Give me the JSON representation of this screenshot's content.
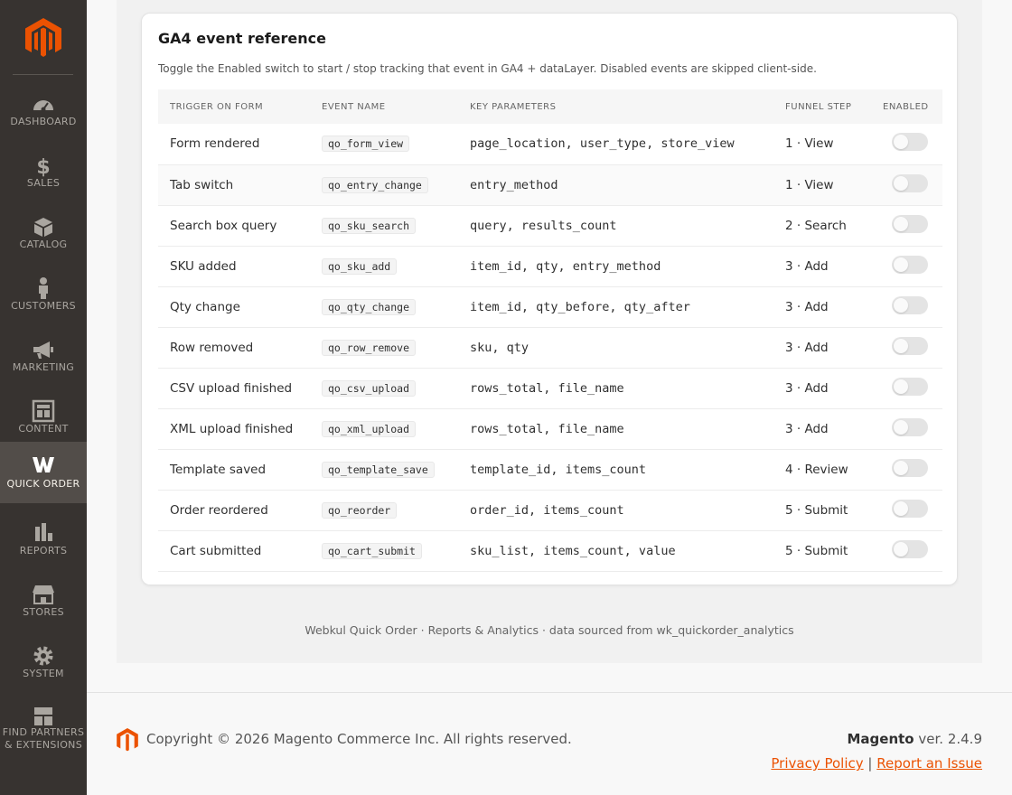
{
  "sidebar": {
    "items": [
      {
        "label": "DASHBOARD",
        "icon": "dashboard-icon"
      },
      {
        "label": "SALES",
        "icon": "dollar-icon"
      },
      {
        "label": "CATALOG",
        "icon": "box-icon"
      },
      {
        "label": "CUSTOMERS",
        "icon": "person-icon"
      },
      {
        "label": "MARKETING",
        "icon": "megaphone-icon"
      },
      {
        "label": "CONTENT",
        "icon": "layout-icon"
      },
      {
        "label": "QUICK ORDER",
        "icon": "webkul-w-icon",
        "active": true
      },
      {
        "label": "REPORTS",
        "icon": "bar-chart-icon"
      },
      {
        "label": "STORES",
        "icon": "storefront-icon"
      },
      {
        "label": "SYSTEM",
        "icon": "gear-icon"
      },
      {
        "label_line1": "FIND PARTNERS",
        "label_line2": "& EXTENSIONS",
        "icon": "cubes-icon"
      }
    ]
  },
  "card": {
    "title": "GA4 event reference",
    "description": "Toggle the Enabled switch to start / stop tracking that event in GA4 + dataLayer. Disabled events are skipped client-side.",
    "columns": [
      "TRIGGER ON FORM",
      "EVENT NAME",
      "KEY PARAMETERS",
      "FUNNEL STEP",
      "ENABLED"
    ],
    "rows": [
      {
        "trigger": "Form rendered",
        "event": "qo_form_view",
        "params": "page_location, user_type, store_view",
        "step": "1 · View",
        "enabled": false
      },
      {
        "trigger": "Tab switch",
        "event": "qo_entry_change",
        "params": "entry_method",
        "step": "1 · View",
        "enabled": false
      },
      {
        "trigger": "Search box query",
        "event": "qo_sku_search",
        "params": "query, results_count",
        "step": "2 · Search",
        "enabled": false
      },
      {
        "trigger": "SKU added",
        "event": "qo_sku_add",
        "params": "item_id, qty, entry_method",
        "step": "3 · Add",
        "enabled": false
      },
      {
        "trigger": "Qty change",
        "event": "qo_qty_change",
        "params": "item_id, qty_before, qty_after",
        "step": "3 · Add",
        "enabled": false
      },
      {
        "trigger": "Row removed",
        "event": "qo_row_remove",
        "params": "sku, qty",
        "step": "3 · Add",
        "enabled": false
      },
      {
        "trigger": "CSV upload finished",
        "event": "qo_csv_upload",
        "params": "rows_total, file_name",
        "step": "3 · Add",
        "enabled": false
      },
      {
        "trigger": "XML upload finished",
        "event": "qo_xml_upload",
        "params": "rows_total, file_name",
        "step": "3 · Add",
        "enabled": false
      },
      {
        "trigger": "Template saved",
        "event": "qo_template_save",
        "params": "template_id, items_count",
        "step": "4 · Review",
        "enabled": false
      },
      {
        "trigger": "Order reordered",
        "event": "qo_reorder",
        "params": "order_id, items_count",
        "step": "5 · Submit",
        "enabled": false
      },
      {
        "trigger": "Cart submitted",
        "event": "qo_cart_submit",
        "params": "sku_list, items_count, value",
        "step": "5 · Submit",
        "enabled": false
      }
    ]
  },
  "content_footer": "Webkul Quick Order · Reports & Analytics · data sourced from wk_quickorder_analytics",
  "footer": {
    "copyright": "Copyright © 2026 Magento Commerce Inc. All rights reserved.",
    "brand": "Magento",
    "version": " ver. 2.4.9",
    "privacy": "Privacy Policy",
    "separator": "|",
    "report": "Report an Issue"
  },
  "colors": {
    "accent": "#eb5202",
    "sidebar": "#373330",
    "sidebar_active": "#524d49"
  }
}
